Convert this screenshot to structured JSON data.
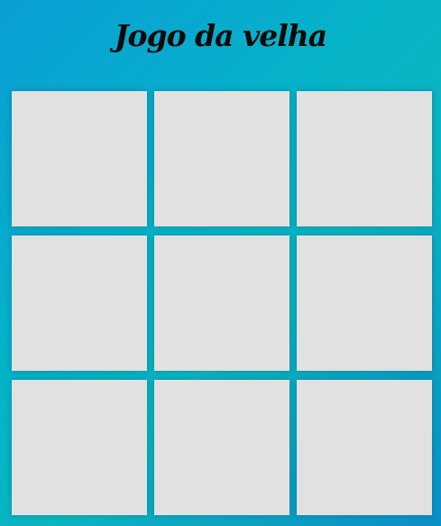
{
  "page": {
    "title": "Jogo da velha"
  },
  "board": {
    "cells": [
      "",
      "",
      "",
      "",
      "",
      "",
      "",
      "",
      ""
    ]
  }
}
